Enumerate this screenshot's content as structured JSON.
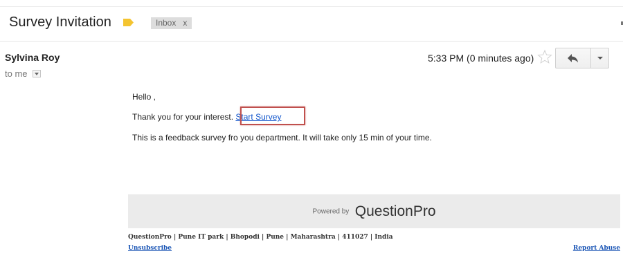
{
  "header": {
    "subject": "Survey Invitation",
    "label_icon": "label-tag-icon",
    "label_color": "#f4c430",
    "chip_label": "Inbox",
    "chip_close": "x"
  },
  "message": {
    "sender": "Sylvina Roy",
    "to_me": "to me",
    "timestamp": "5:33 PM (0 minutes ago)",
    "star_icon": "star-icon",
    "reply_icon": "reply-icon",
    "more_icon": "chevron-down-icon",
    "greeting": "Hello ,",
    "thanks_text": "Thank you for your interest.",
    "survey_link": "Start Survey ",
    "info_text": "This is a feedback survey fro you department. It will take only 15 min of your time.",
    "highlight_color": "#c0504d"
  },
  "footer": {
    "powered_by": "Powered by",
    "brand": "QuestionPro",
    "address": "QuestionPro | Pune IT park | Bhopodi | Pune | Maharashtra | 411027 | India",
    "unsubscribe": "Unsubscribe",
    "report_abuse": "Report Abuse"
  }
}
